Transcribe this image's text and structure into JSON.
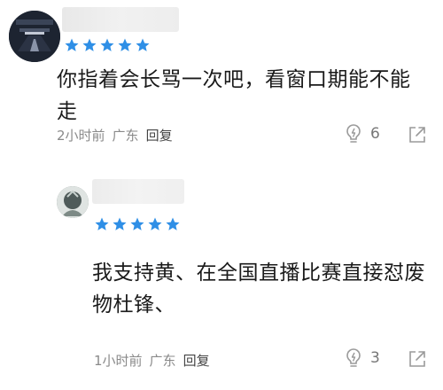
{
  "comments": [
    {
      "username": "",
      "rating": 5,
      "text": "你指着会长骂一次吧，看窗口期能不能走",
      "time": "2小时前",
      "location": "广东",
      "reply_label": "回复",
      "likes": "6"
    },
    {
      "username": "",
      "rating": 5,
      "text": "我支持黄、在全国直播比赛直接怼废物杜锋、",
      "time": "1小时前",
      "location": "广东",
      "reply_label": "回复",
      "likes": "3"
    }
  ],
  "colors": {
    "star": "#2f8fe6",
    "icon": "#9a9a9a",
    "meta": "#8a8a8a"
  }
}
